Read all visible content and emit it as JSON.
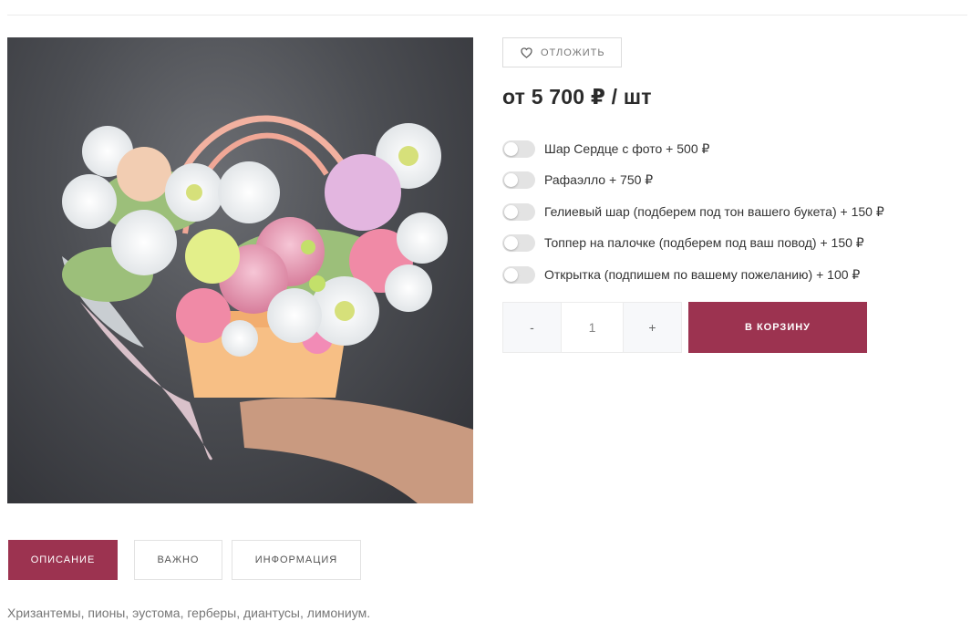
{
  "product": {
    "image_alt": "",
    "wishlist_label": "ОТЛОЖИТЬ",
    "price": "от 5 700 ₽ / шт",
    "options": [
      {
        "label": "Шар Сердце с фото + 500 ₽",
        "enabled": false
      },
      {
        "label": "Рафаэлло + 750 ₽",
        "enabled": false
      },
      {
        "label": "Гелиевый шар (подберем под тон вашего букета) + 150 ₽",
        "enabled": false
      },
      {
        "label": "Топпер на палочке (подберем под ваш повод) + 150 ₽",
        "enabled": false
      },
      {
        "label": "Открытка (подпишем по вашему пожеланию) + 100 ₽",
        "enabled": false
      }
    ],
    "quantity": {
      "minus": "-",
      "value": "1",
      "plus": "+"
    },
    "cart_label": "В КОРЗИНУ"
  },
  "tabs": [
    {
      "label": "ОПИСАНИЕ",
      "active": true
    },
    {
      "label": "ВАЖНО",
      "active": false
    },
    {
      "label": "ИНФОРМАЦИЯ",
      "active": false
    }
  ],
  "description": "Хризантемы, пионы, эустома, герберы, диантусы, лимониум.",
  "colors": {
    "accent": "#9c3350",
    "toggle_off": "#e3e3e3",
    "border": "#e2e2e2"
  }
}
